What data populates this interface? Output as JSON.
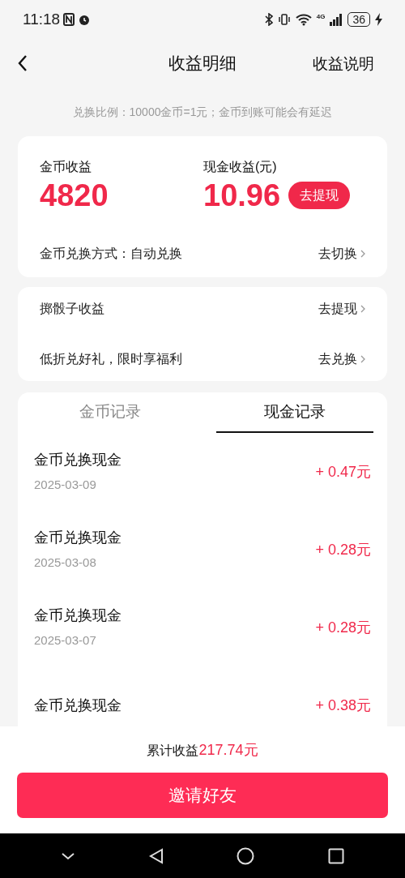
{
  "status_bar": {
    "time": "11:18",
    "network": "4G",
    "battery": "36"
  },
  "header": {
    "title": "收益明细",
    "action": "收益说明"
  },
  "notice": "兑换比例：10000金币=1元；金币到账可能会有延迟",
  "summary": {
    "coin_label": "金币收益",
    "coin_value": "4820",
    "cash_label": "现金收益(元)",
    "cash_value": "10.96",
    "withdraw_button": "去提现",
    "mode_label": "金币兑换方式：自动兑换",
    "mode_action": "去切换"
  },
  "links": [
    {
      "label": "掷骰子收益",
      "action": "去提现"
    },
    {
      "label": "低折兑好礼，限时享福利",
      "action": "去兑换"
    }
  ],
  "tabs": [
    {
      "label": "金币记录",
      "selected": false
    },
    {
      "label": "现金记录",
      "selected": true
    }
  ],
  "records": [
    {
      "title": "金币兑换现金",
      "date": "2025-03-09",
      "amount": "+ 0.47元"
    },
    {
      "title": "金币兑换现金",
      "date": "2025-03-08",
      "amount": "+ 0.28元"
    },
    {
      "title": "金币兑换现金",
      "date": "2025-03-07",
      "amount": "+ 0.28元"
    },
    {
      "title": "金币兑换现金",
      "amount": "+ 0.38元"
    }
  ],
  "footer": {
    "total_label": "累计收益",
    "total_value": "217.74元",
    "invite_button": "邀请好友"
  }
}
